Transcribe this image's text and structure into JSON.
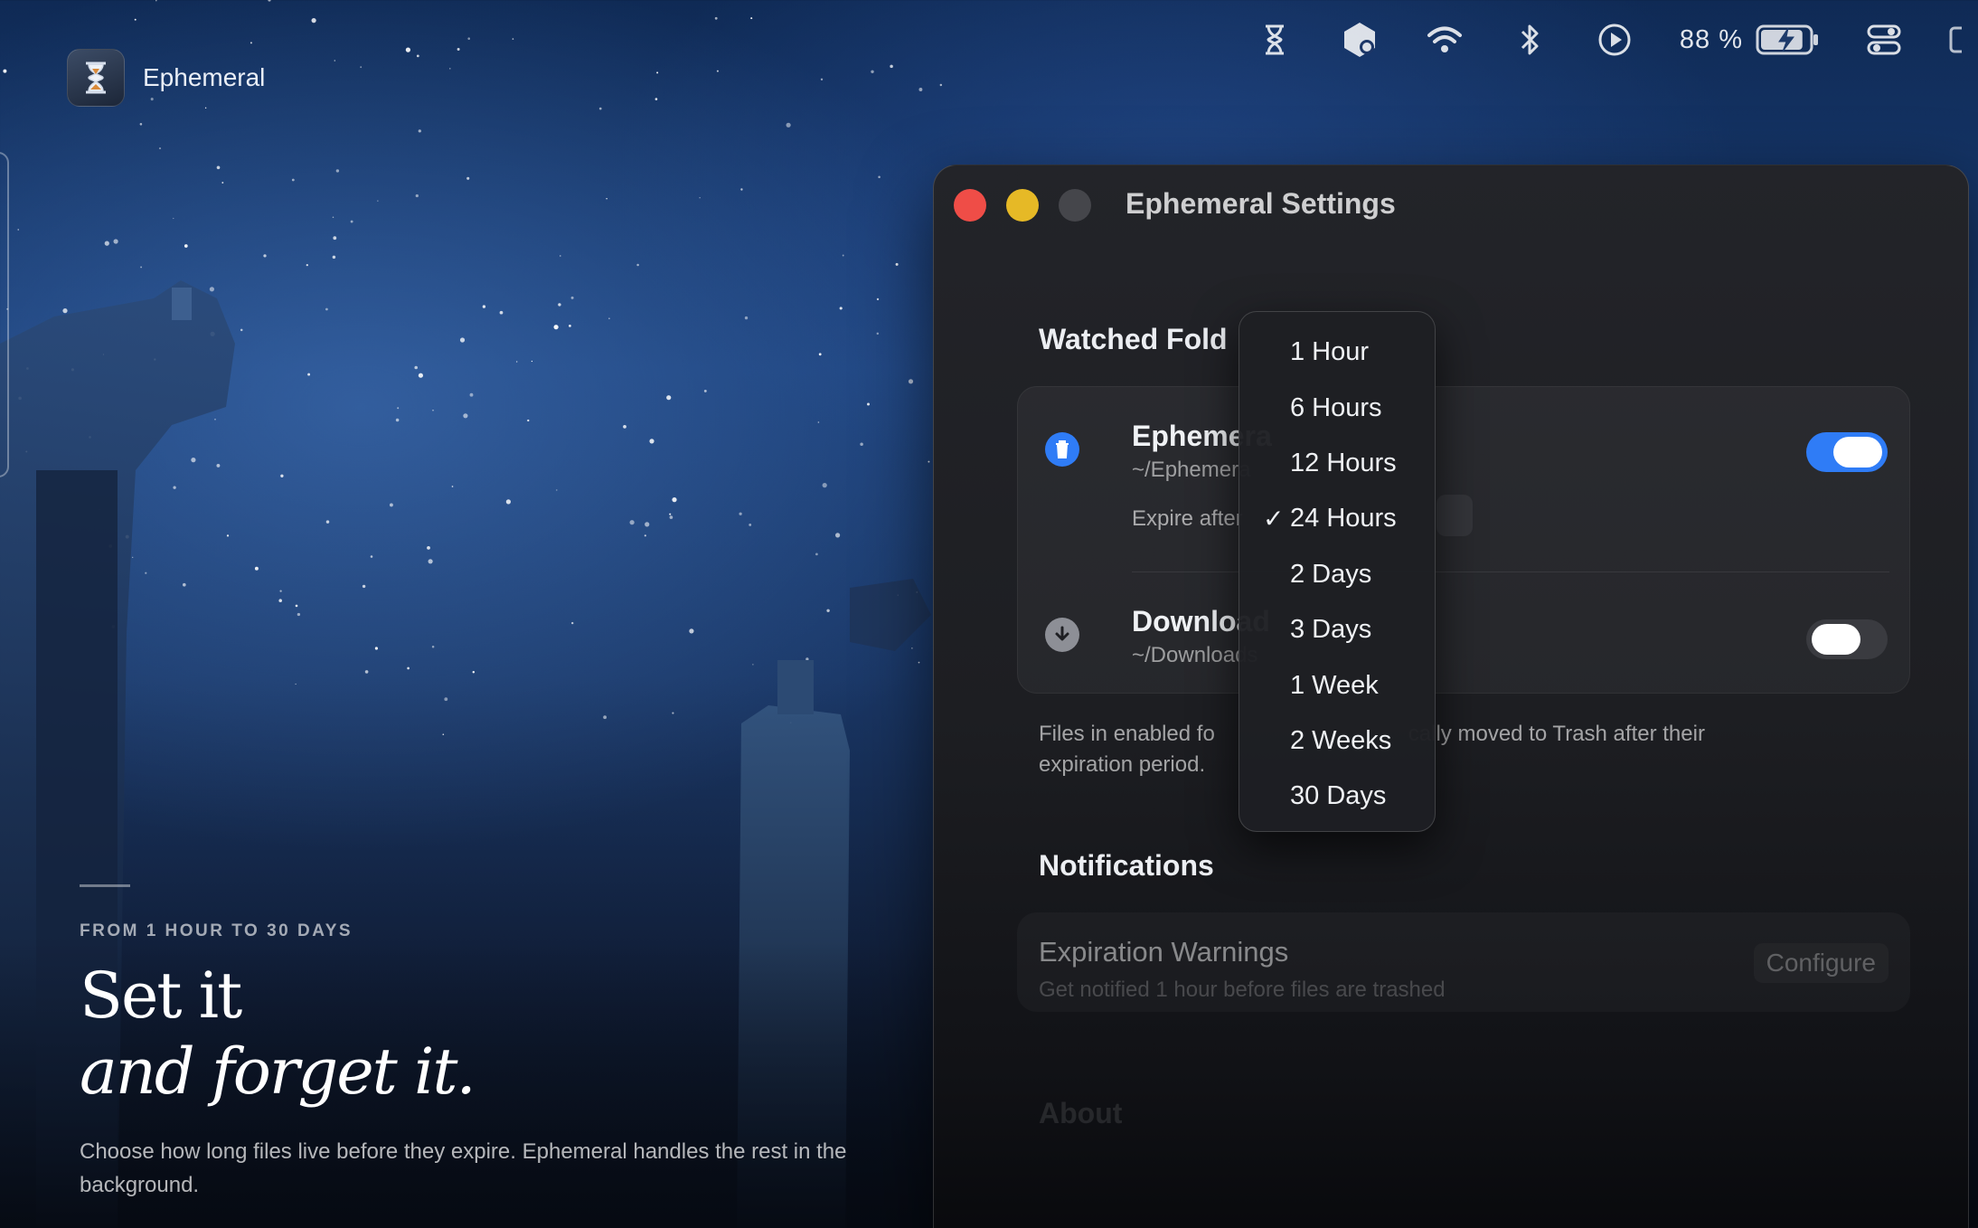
{
  "menubar": {
    "icons": [
      "hourglass-icon",
      "app-badge-icon",
      "wifi-icon",
      "bluetooth-icon",
      "play-circle-icon"
    ],
    "battery_percent": "88 %",
    "battery_level": 0.88,
    "trailing_icon": "control-center-icon"
  },
  "brand": {
    "name": "Ephemeral",
    "icon": "hourglass-icon"
  },
  "hero": {
    "eyebrow": "FROM 1 HOUR TO 30 DAYS",
    "headline_line1": "Set it",
    "headline_line2": "and forget it.",
    "body": "Choose how long files live before they expire. Ephemeral handles the rest in the background."
  },
  "window": {
    "title": "Ephemeral Settings",
    "watched_folders_title": "Watched Fold",
    "folders": [
      {
        "name": "Ephemera",
        "path": "~/Ephemera",
        "expire_label": "Expire after",
        "enabled": true,
        "icon": "trash-icon",
        "accent": "#2f7cf6"
      },
      {
        "name": "Download",
        "path": "~/Downloads",
        "enabled": false,
        "icon": "download-icon"
      }
    ],
    "note_line1_a": "Files in enabled fo",
    "note_line1_b": "cally moved to Trash after their",
    "note_line2": "expiration period.",
    "notifications_title": "Notifications",
    "expiration_warnings": {
      "title": "Expiration Warnings",
      "subtitle": "Get notified 1 hour before files are trashed",
      "button": "Configure"
    },
    "about_title": "About"
  },
  "expire_menu": {
    "selected": "24 Hours",
    "options": [
      "1 Hour",
      "6 Hours",
      "12 Hours",
      "24 Hours",
      "2 Days",
      "3 Days",
      "1 Week",
      "2 Weeks",
      "30 Days"
    ]
  }
}
